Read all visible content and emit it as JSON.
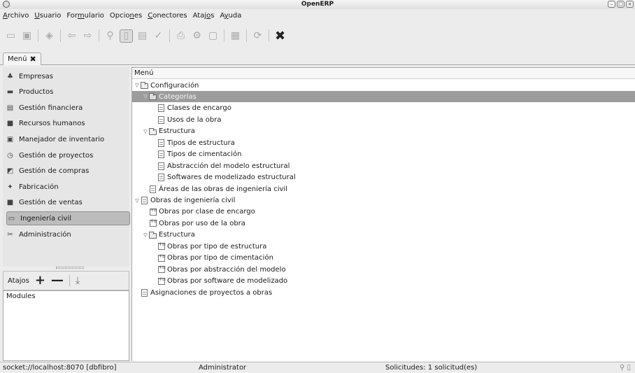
{
  "window": {
    "title": "OpenERP"
  },
  "menubar": [
    {
      "pre": "",
      "key": "A",
      "post": "rchivo"
    },
    {
      "pre": "",
      "key": "U",
      "post": "suario"
    },
    {
      "pre": "For",
      "key": "m",
      "post": "ulario"
    },
    {
      "pre": "Opcio",
      "key": "n",
      "post": "es"
    },
    {
      "pre": "",
      "key": "C",
      "post": "onectores"
    },
    {
      "pre": "Ataj",
      "key": "o",
      "post": "s"
    },
    {
      "pre": "A",
      "key": "y",
      "post": "uda"
    }
  ],
  "toolbar_icons": [
    "new-icon",
    "save-icon",
    "delete-icon",
    "previous-icon",
    "next-icon",
    "search-icon",
    "form-view-icon",
    "list-view-icon",
    "spell-check-icon",
    "print-icon",
    "plugins-icon",
    "attachment-icon",
    "calendar-icon",
    "reload-icon",
    "close-icon"
  ],
  "tab": {
    "label": "Menú"
  },
  "modules": [
    {
      "label": "Empresas",
      "icon": "partners-icon"
    },
    {
      "label": "Productos",
      "icon": "products-icon"
    },
    {
      "label": "Gestión financiera",
      "icon": "accounting-icon"
    },
    {
      "label": "Recursos humanos",
      "icon": "hr-icon"
    },
    {
      "label": "Manejador de inventario",
      "icon": "stock-icon"
    },
    {
      "label": "Gestión de proyectos",
      "icon": "project-icon"
    },
    {
      "label": "Gestión de compras",
      "icon": "purchase-icon"
    },
    {
      "label": "Fabricación",
      "icon": "manufacturing-icon"
    },
    {
      "label": "Gestión de ventas",
      "icon": "sales-icon"
    },
    {
      "label": "Ingeniería civil",
      "icon": "folder-icon",
      "selected": true
    },
    {
      "label": "Administración",
      "icon": "administration-icon"
    }
  ],
  "shortcuts": {
    "title": "Atajos",
    "items": [
      "Modules"
    ]
  },
  "menu_tree": {
    "header": "Menú",
    "rows": [
      {
        "label": "Configuración",
        "depth": 0,
        "expanded": true,
        "icon": "folder"
      },
      {
        "label": "Categorías",
        "depth": 1,
        "expanded": true,
        "icon": "folder",
        "selected": true
      },
      {
        "label": "Clases de encargo",
        "depth": 2,
        "icon": "doc"
      },
      {
        "label": "Usos de la obra",
        "depth": 2,
        "icon": "doc"
      },
      {
        "label": "Estructura",
        "depth": 1,
        "expanded": true,
        "icon": "folder"
      },
      {
        "label": "Tipos de estructura",
        "depth": 2,
        "icon": "doc"
      },
      {
        "label": "Tipos de cimentación",
        "depth": 2,
        "icon": "doc"
      },
      {
        "label": "Abstracción del modelo estructural",
        "depth": 2,
        "icon": "doc"
      },
      {
        "label": "Softwares de modelizado estructural",
        "depth": 2,
        "icon": "doc"
      },
      {
        "label": "Áreas de las obras de ingeniería civil",
        "depth": 1,
        "icon": "doc"
      },
      {
        "label": "Obras de ingeniería civil",
        "depth": 0,
        "expanded": true,
        "icon": "doc"
      },
      {
        "label": "Obras por clase de encargo",
        "depth": 1,
        "icon": "tree"
      },
      {
        "label": "Obras por uso de la obra",
        "depth": 1,
        "icon": "tree"
      },
      {
        "label": "Estructura",
        "depth": 1,
        "expanded": true,
        "icon": "folder"
      },
      {
        "label": "Obras por tipo de estructura",
        "depth": 2,
        "icon": "tree"
      },
      {
        "label": "Obras por tipo de cimentación",
        "depth": 2,
        "icon": "tree"
      },
      {
        "label": "Obras por abstracción del modelo",
        "depth": 2,
        "icon": "tree"
      },
      {
        "label": "Obras por software de modelizado",
        "depth": 2,
        "icon": "tree"
      },
      {
        "label": "Asignaciones de proyectos a obras",
        "depth": 0,
        "icon": "doc"
      }
    ]
  },
  "status": {
    "connection": "socket://localhost:8070 [dbfibro]",
    "user": "Administrator",
    "requests": "Solicitudes:  1 solicitud(es)"
  }
}
